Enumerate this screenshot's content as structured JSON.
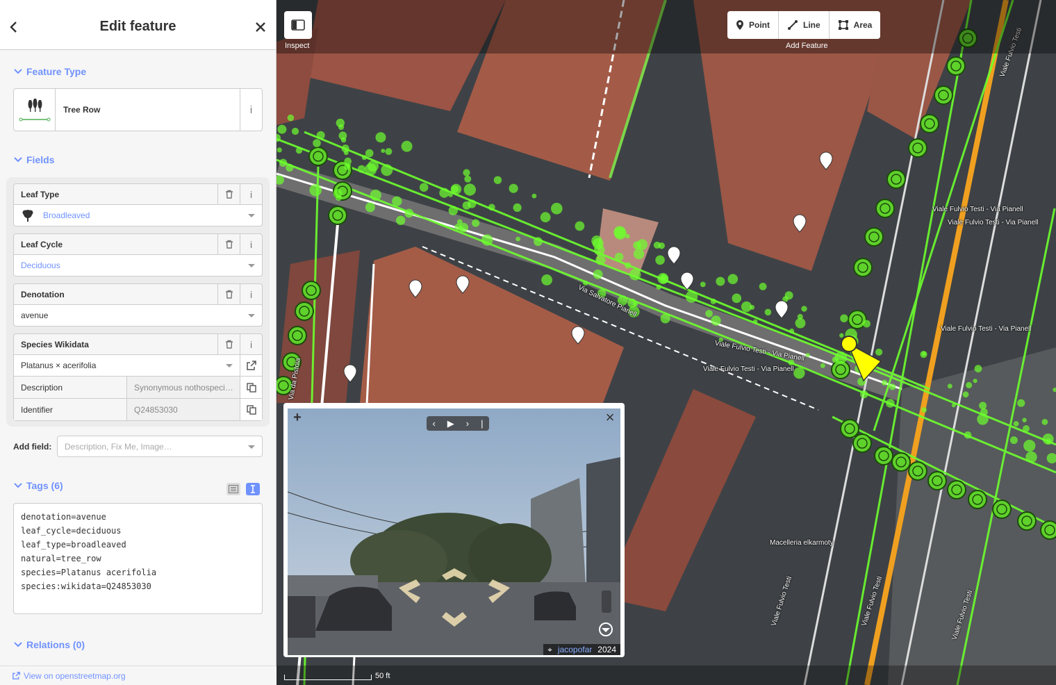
{
  "header": {
    "title": "Edit feature"
  },
  "sections": {
    "feature_type": "Feature Type",
    "fields": "Fields",
    "tags": "Tags (6)",
    "relations": "Relations (0)"
  },
  "feature": {
    "name": "Tree Row",
    "info": "i"
  },
  "fields": {
    "leaf_type": {
      "label": "Leaf Type",
      "value": "Broadleaved"
    },
    "leaf_cycle": {
      "label": "Leaf Cycle",
      "value": "Deciduous"
    },
    "denotation": {
      "label": "Denotation",
      "value": "avenue"
    },
    "species": {
      "label": "Species Wikidata",
      "value": "Platanus × acerifolia",
      "description_label": "Description",
      "description_value": "Synonymous nothospeci…",
      "identifier_label": "Identifier",
      "identifier_value": "Q24853030"
    }
  },
  "add_field": {
    "label": "Add field:",
    "placeholder": "Description, Fix Me, Image…"
  },
  "tags_text": "denotation=avenue\nleaf_cycle=deciduous\nleaf_type=broadleaved\nnatural=tree_row\nspecies=Platanus acerifolia\nspecies:wikidata=Q24853030",
  "footer": {
    "link": "View on openstreetmap.org"
  },
  "map": {
    "inspect_label": "Inspect",
    "modes": [
      "Point",
      "Line",
      "Area"
    ],
    "add_feature_label": "Add Feature",
    "scale_label": "50 ft",
    "street_labels": [
      "Viale Fulvio Testi - Via Pianell",
      "Viale Fulvio Testi - Via Pianell",
      "Viale Fulvio Testi - Via Pianell",
      "Viale Fulvio Testi - Via Pianell",
      "Viale Fulvio Testi - Via Pianell",
      "Via Salvatore Pianell",
      "Viale Fulvio Testi",
      "Viale Fulvio Testi",
      "Viale Fulvio Testi",
      "Viale Fulvio Testi",
      "Via da Pistoia",
      "Macelleria elkarmoty"
    ]
  },
  "photo": {
    "user": "jacopofar",
    "year": "2024",
    "plus": "+",
    "close": "×"
  },
  "colors": {
    "accent": "#7092ff",
    "osm_green": "#6dff2e",
    "selected": "#ffff00"
  }
}
